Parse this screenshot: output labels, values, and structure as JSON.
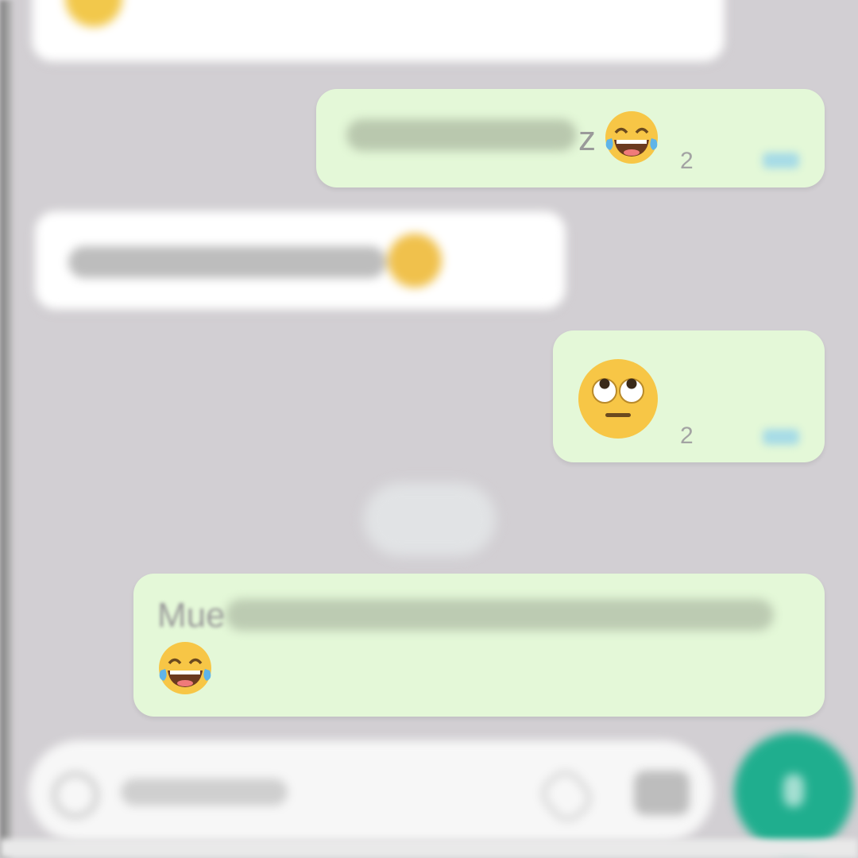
{
  "messages": [
    {
      "direction": "incoming",
      "text": "",
      "emoji": "grinning-face",
      "time": ""
    },
    {
      "direction": "outgoing",
      "text": "",
      "tail_letter": "z",
      "emoji": "face-with-tears-of-joy",
      "time_fragment": "2"
    },
    {
      "direction": "incoming",
      "text": "",
      "emoji": "grinning-face",
      "time": ""
    },
    {
      "direction": "outgoing",
      "text": "",
      "emoji": "face-with-rolling-eyes",
      "time_fragment": "2"
    },
    {
      "direction": "outgoing",
      "text": "Mue",
      "emoji": "face-with-tears-of-joy",
      "time": ""
    }
  ],
  "date_separator": "",
  "input": {
    "placeholder": "",
    "emoji_icon": "smiley-icon",
    "attach_icon": "paperclip-icon",
    "camera_icon": "camera-icon"
  },
  "send_button": {
    "icon": "microphone-icon"
  },
  "colors": {
    "chat_background": "#d2cfd3",
    "incoming_bubble": "#ffffff",
    "outgoing_bubble": "#e4f8d8",
    "send_button": "#1fae8e"
  }
}
